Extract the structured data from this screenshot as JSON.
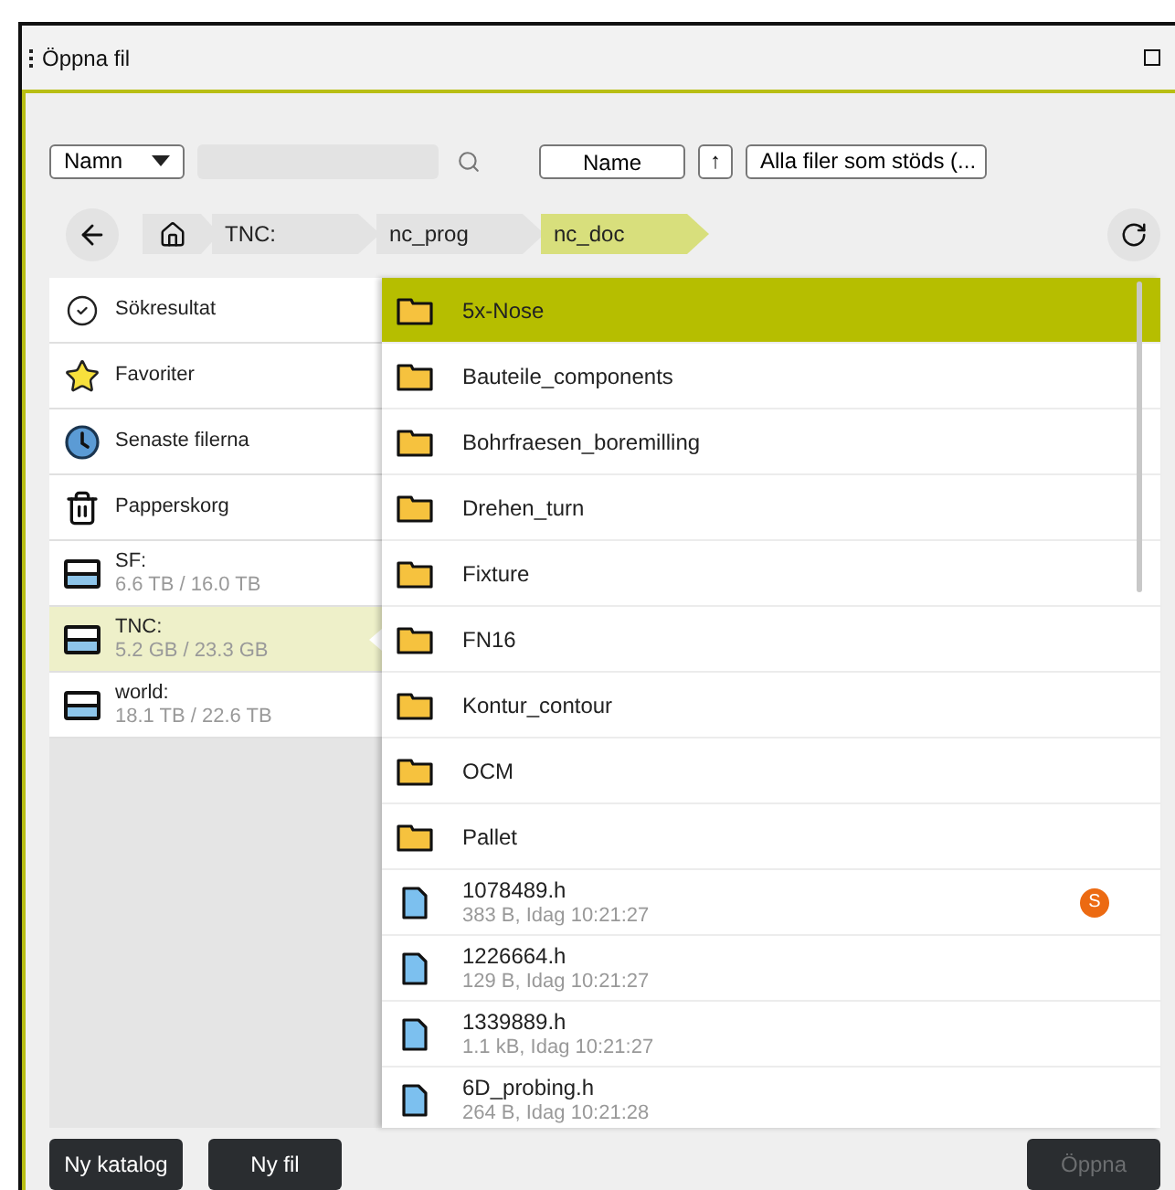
{
  "window": {
    "title": "Öppna fil"
  },
  "toolbar": {
    "sort_field": "Namn",
    "sort_button": "Name",
    "direction": "↑",
    "filter": "Alla filer som stöds (..."
  },
  "breadcrumb": [
    {
      "label": "TNC:",
      "selected": false
    },
    {
      "label": "nc_prog",
      "selected": false
    },
    {
      "label": "nc_doc",
      "selected": true
    }
  ],
  "sidebar": [
    {
      "kind": "search",
      "label": "Sökresultat",
      "selected": false
    },
    {
      "kind": "favorites",
      "label": "Favoriter",
      "selected": false
    },
    {
      "kind": "recent",
      "label": "Senaste filerna",
      "selected": false
    },
    {
      "kind": "trash",
      "label": "Papperskorg",
      "selected": false
    },
    {
      "kind": "drive",
      "label": "SF:",
      "detail": "6.6 TB / 16.0 TB",
      "selected": false
    },
    {
      "kind": "drive",
      "label": "TNC:",
      "detail": "5.2 GB / 23.3 GB",
      "selected": true
    },
    {
      "kind": "drive",
      "label": "world:",
      "detail": "18.1 TB / 22.6 TB",
      "selected": false
    }
  ],
  "files": [
    {
      "kind": "folder",
      "name": "5x-Nose",
      "selected": true
    },
    {
      "kind": "folder",
      "name": "Bauteile_components",
      "selected": false
    },
    {
      "kind": "folder",
      "name": "Bohrfraesen_boremilling",
      "selected": false
    },
    {
      "kind": "folder",
      "name": "Drehen_turn",
      "selected": false
    },
    {
      "kind": "folder",
      "name": "Fixture",
      "selected": false
    },
    {
      "kind": "folder",
      "name": "FN16",
      "selected": false
    },
    {
      "kind": "folder",
      "name": "Kontur_contour",
      "selected": false
    },
    {
      "kind": "folder",
      "name": "OCM",
      "selected": false
    },
    {
      "kind": "folder",
      "name": "Pallet",
      "selected": false
    },
    {
      "kind": "file",
      "name": "1078489.h",
      "meta": "383 B, Idag 10:21:27",
      "badge": "S",
      "selected": false
    },
    {
      "kind": "file",
      "name": "1226664.h",
      "meta": "129 B, Idag 10:21:27",
      "selected": false
    },
    {
      "kind": "file",
      "name": "1339889.h",
      "meta": "1.1 kB, Idag 10:21:27",
      "selected": false
    },
    {
      "kind": "file",
      "name": "6D_probing.h",
      "meta": "264 B, Idag 10:21:28",
      "selected": false
    }
  ],
  "buttons": [
    {
      "label": "Ny katalog",
      "disabled": false
    },
    {
      "label": "Ny fil",
      "disabled": false
    },
    {
      "label": "Öppna",
      "disabled": true
    }
  ]
}
